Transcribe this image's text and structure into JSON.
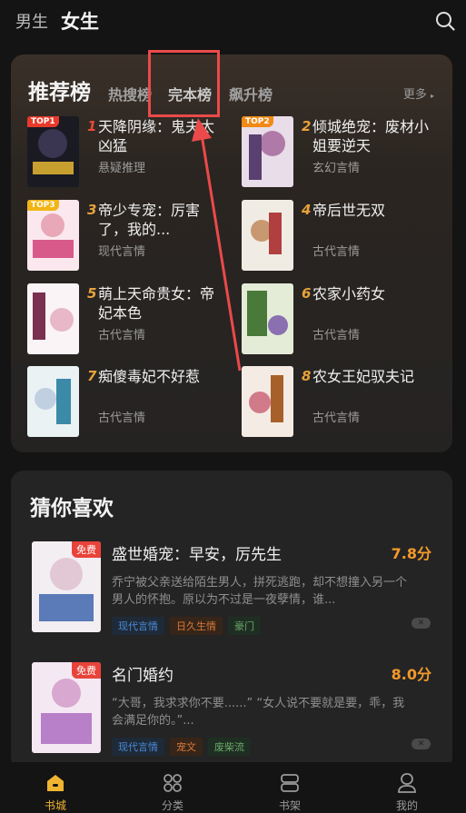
{
  "top_tabs": {
    "male": "男生",
    "female": "女生"
  },
  "rank": {
    "title": "推荐榜",
    "tabs": [
      "热搜榜",
      "完本榜",
      "飙升榜"
    ],
    "more": "更多",
    "items": [
      {
        "num": "1",
        "name": "天降阴缘：鬼夫太凶猛",
        "genre": "悬疑推理",
        "badge": "TOP1"
      },
      {
        "num": "2",
        "name": "倾城绝宠：废材小姐要逆天",
        "genre": "玄幻言情",
        "badge": "TOP2"
      },
      {
        "num": "3",
        "name": "帝少专宠：厉害了，我的...",
        "genre": "现代言情",
        "badge": "TOP3"
      },
      {
        "num": "4",
        "name": "帝后世无双",
        "genre": "古代言情",
        "badge": ""
      },
      {
        "num": "5",
        "name": "萌上天命贵女：帝妃本色",
        "genre": "古代言情",
        "badge": ""
      },
      {
        "num": "6",
        "name": "农家小药女",
        "genre": "古代言情",
        "badge": ""
      },
      {
        "num": "7",
        "name": "痴傻毒妃不好惹",
        "genre": "古代言情",
        "badge": ""
      },
      {
        "num": "8",
        "name": "农女王妃驭夫记",
        "genre": "古代言情",
        "badge": ""
      }
    ]
  },
  "guess": {
    "title": "猜你喜欢",
    "books": [
      {
        "free": "免费",
        "name": "盛世婚宠：早安，厉先生",
        "score": "7.8分",
        "desc": "乔宁被父亲送给陌生男人，拼死逃跑，却不想撞入另一个男人的怀抱。原以为不过是一夜孽情，谁...",
        "tags": [
          "现代言情",
          "日久生情",
          "豪门"
        ]
      },
      {
        "free": "免费",
        "name": "名门婚约",
        "score": "8.0分",
        "desc": "“大哥，我求求你不要......” “女人说不要就是要，乖，我会满足你的。”...",
        "tags": [
          "现代言情",
          "宠文",
          "废柴流"
        ]
      }
    ]
  },
  "nav": [
    {
      "label": "书城",
      "icon": "home-icon"
    },
    {
      "label": "分类",
      "icon": "grid-icon"
    },
    {
      "label": "书架",
      "icon": "bookshelf-icon"
    },
    {
      "label": "我的",
      "icon": "user-icon"
    }
  ],
  "colors": {
    "accent": "#f0b431",
    "highlight": "#ea4a4a",
    "score": "#f29a2a"
  }
}
